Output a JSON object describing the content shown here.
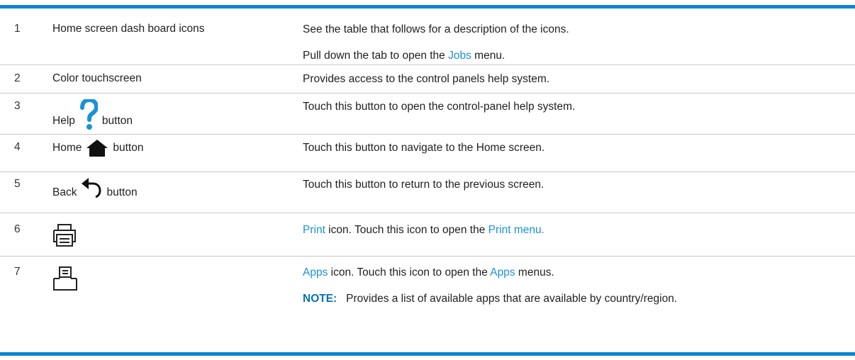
{
  "rows": [
    {
      "num": "1",
      "item": "Home screen dash board icons",
      "desc": "See the table that follows for a description of the icons.",
      "desc2_pre": "Pull down the tab to open the ",
      "desc2_link": "Jobs",
      "desc2_post": " menu."
    },
    {
      "num": "2",
      "item": "Color touchscreen",
      "desc": "Provides access to the control panels help system."
    },
    {
      "num": "3",
      "item_label": "Help",
      "item_suffix": "button",
      "icon": "question-mark-icon",
      "desc": "Touch this button to open the control-panel help system."
    },
    {
      "num": "4",
      "item_label": "Home",
      "item_suffix": "button",
      "icon": "home-icon",
      "desc": "Touch this button to navigate to the Home screen."
    },
    {
      "num": "5",
      "item_label": "Back",
      "item_suffix": "button",
      "icon": "back-arrow-icon",
      "desc": "Touch this button to return to the previous screen."
    },
    {
      "num": "6",
      "icon": "print-icon",
      "desc_link1": "Print",
      "desc_mid": " icon. Touch this icon to open the ",
      "desc_link2": "Print menu."
    },
    {
      "num": "7",
      "icon": "apps-icon",
      "desc_link1": "Apps",
      "desc_mid": " icon. Touch this icon to open the ",
      "desc_link2": "Apps",
      "desc_post": " menus.",
      "note_label": "NOTE:",
      "note_text": "Provides a list of available apps that are available by country/region."
    }
  ],
  "colors": {
    "accent": "#0b85d0",
    "link": "#1a92d6",
    "divider": "#c8c8c8"
  }
}
